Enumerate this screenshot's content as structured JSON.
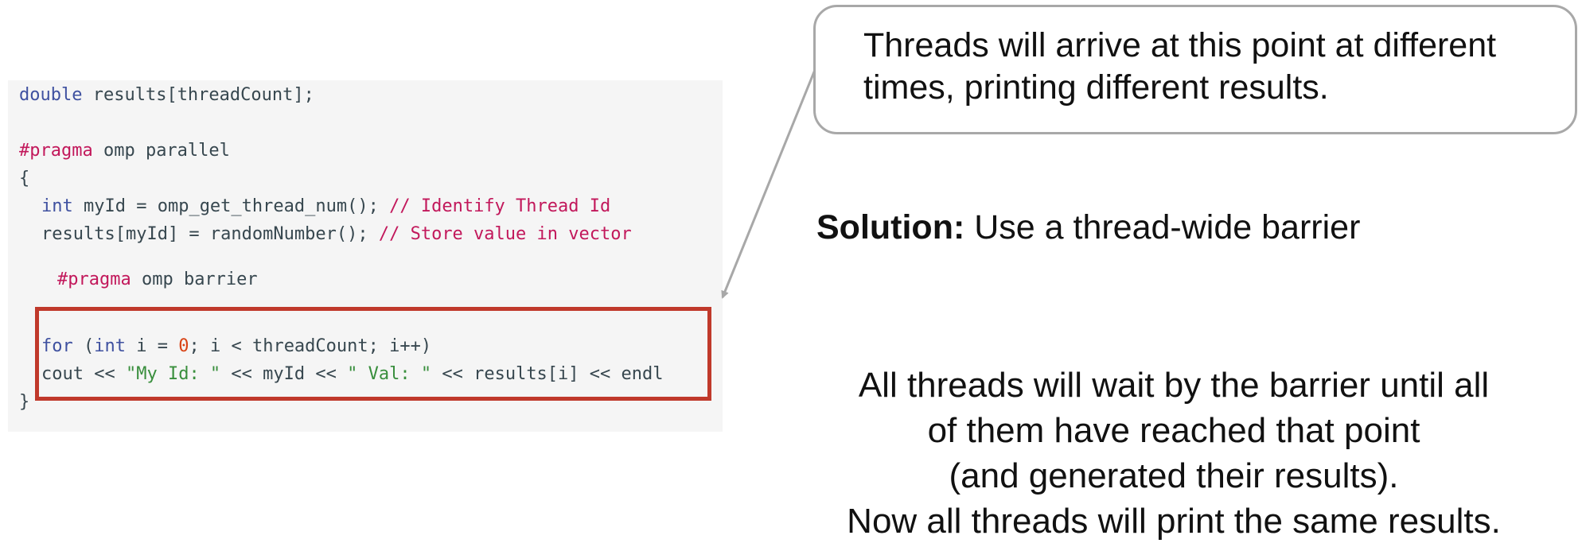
{
  "code": {
    "l1_kw": "double",
    "l1_rest": " results[threadCount];",
    "l2_pp": "#pragma",
    "l2_rest": " omp parallel",
    "l3": "{",
    "l4_kw": "int",
    "l4_rest": " myId = omp_get_thread_num(); ",
    "l4_cm": "// Identify Thread Id",
    "l5_rest": "results[myId] = randomNumber(); ",
    "l5_cm": "// Store value in vector",
    "l6_pp": "#pragma",
    "l6_rest": " omp barrier",
    "l7_for": "for",
    "l7_a": " (",
    "l7_int": "int",
    "l7_b": " i = ",
    "l7_num": "0",
    "l7_c": "; i < threadCount; i++)",
    "l8_a": "cout << ",
    "l8_s1": "\"My Id: \"",
    "l8_b": " << myId << ",
    "l8_s2": "\" Val: \"",
    "l8_c": " << results[i] << endl",
    "l9": "}"
  },
  "callout": {
    "line1": "Threads will arrive at this point at different",
    "line2": "times, printing different results."
  },
  "solution": {
    "label": "Solution:",
    "text": " Use a thread-wide barrier"
  },
  "explanation": {
    "line1": "All threads will wait by the barrier until all",
    "line2": "of them have reached that point",
    "line3": "(and generated their results).",
    "line4": "Now all threads will print the same results."
  },
  "colors": {
    "highlight_border": "#c0392b",
    "code_background": "#f5f5f5",
    "callout_border": "#a8a8a8"
  }
}
